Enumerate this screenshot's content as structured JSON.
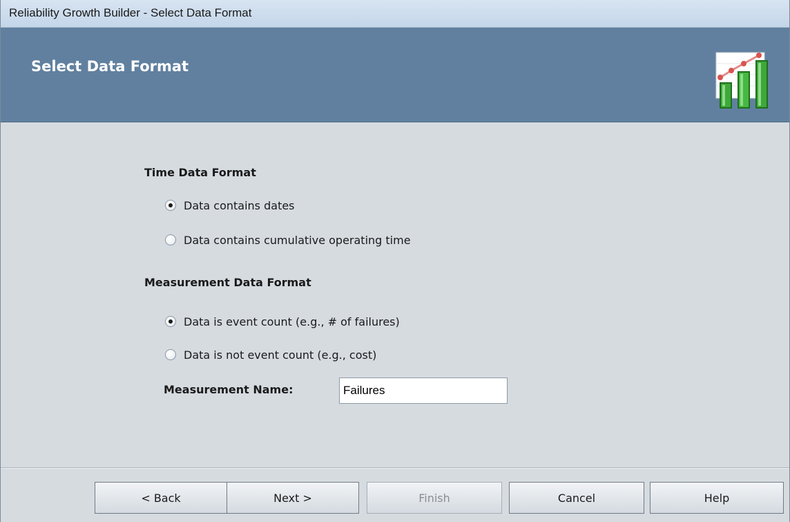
{
  "window": {
    "title": "Reliability Growth Builder - Select Data Format"
  },
  "header": {
    "title": "Select Data Format",
    "icon": "growth-chart-icon"
  },
  "time_format": {
    "title": "Time Data Format",
    "options": [
      {
        "label": "Data contains dates",
        "checked": true
      },
      {
        "label": "Data contains cumulative operating time",
        "checked": false
      }
    ]
  },
  "measurement_format": {
    "title": "Measurement Data Format",
    "options": [
      {
        "label": "Data is event count (e.g., # of failures)",
        "checked": true
      },
      {
        "label": "Data is not event count (e.g., cost)",
        "checked": false
      }
    ]
  },
  "measurement_name": {
    "label": "Measurement Name:",
    "value": "Failures"
  },
  "buttons": {
    "back": "< Back",
    "next": "Next >",
    "finish": "Finish",
    "cancel": "Cancel",
    "help": "Help"
  },
  "colors": {
    "header_band": "#61809f",
    "dialog_body": "#d6dbe0",
    "icon_bars": "#3fa83a",
    "icon_trend": "#d9534f"
  }
}
